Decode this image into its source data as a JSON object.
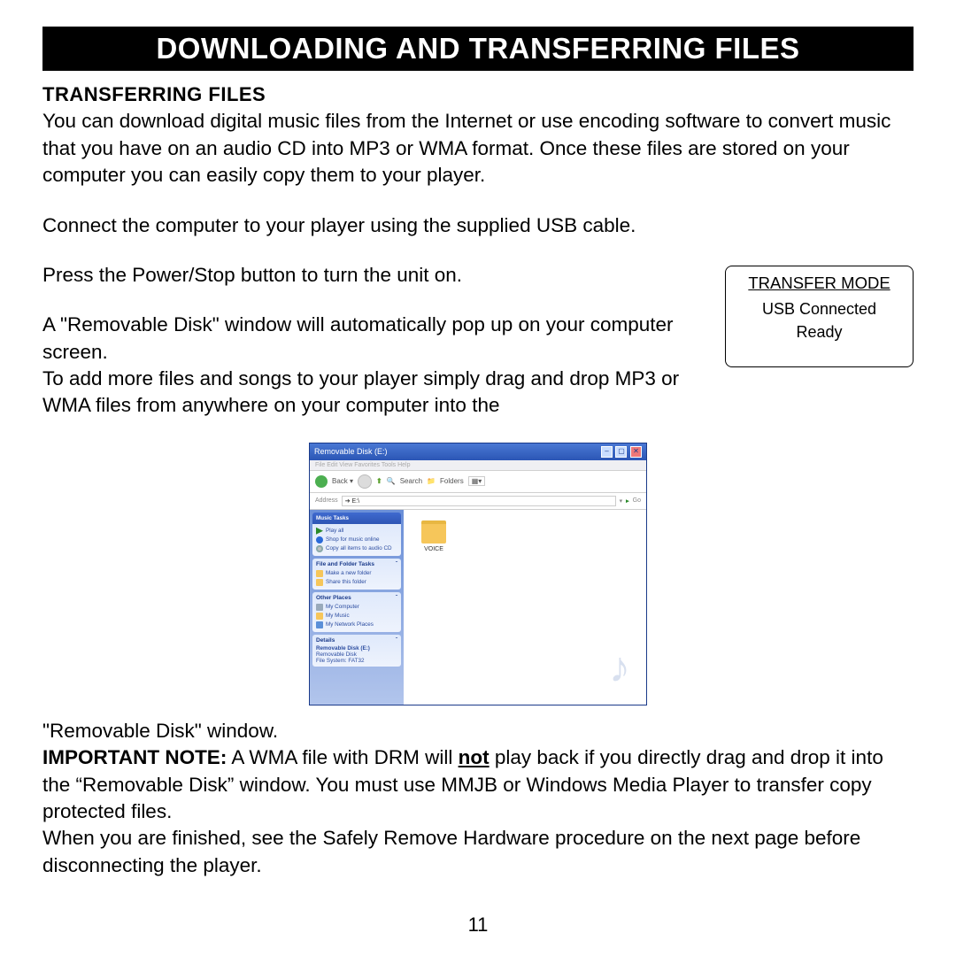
{
  "title_bar": "DOWNLOADING AND TRANSFERRING FILES",
  "section_heading": "TRANSFERRING FILES",
  "para1": "You can download digital music files from the Internet or use encoding software to convert music that you have on an audio CD into MP3 or WMA format. Once these files are stored on your computer you can easily copy them to your player.",
  "para2": "Connect the computer to your player using the supplied USB cable.",
  "para3": "Press the Power/Stop  button to turn the unit on.",
  "para4": "A \"Removable Disk\" window will automatically pop up on your computer screen.",
  "para5": "To add more files and songs to your player simply drag and drop MP3 or WMA  files from anywhere on your computer into the",
  "transfer_box": {
    "title": "TRANSFER MODE",
    "line1": "USB Connected",
    "line2": "Ready"
  },
  "xp_window": {
    "title": "Removable Disk (E:)",
    "menu": "File   Edit   View   Favorites   Tools   Help",
    "toolbar_back": "Back ▾",
    "toolbar_search": "Search",
    "toolbar_folders": "Folders",
    "address_label": "Address",
    "address_value": "➔ E:\\",
    "go": "Go",
    "panel_music": {
      "title": "Music Tasks",
      "items": [
        "Play all",
        "Shop for music online",
        "Copy all items to audio CD"
      ]
    },
    "panel_file": {
      "title": "File and Folder Tasks",
      "items": [
        "Make a new folder",
        "Share this folder"
      ]
    },
    "panel_other": {
      "title": "Other Places",
      "items": [
        "My Computer",
        "My Music",
        "My Network Places"
      ]
    },
    "panel_details": {
      "title": "Details",
      "lines": [
        "Removable Disk (E:)",
        "Removable Disk",
        "File System: FAT32"
      ]
    },
    "folder_name": "VOICE"
  },
  "para6": "\"Removable Disk\" window.",
  "note_label": "IMPORTANT NOTE:",
  "note_part1": " A WMA file with DRM will ",
  "note_not": "not",
  "note_part2": " play back if you directly drag and drop it into the “Removable Disk” window. You must use MMJB or Windows Media Player to transfer copy protected files.",
  "para7": "When you are finished, see the Safely Remove Hardware procedure on the next page before disconnecting the player.",
  "page_number": "11"
}
